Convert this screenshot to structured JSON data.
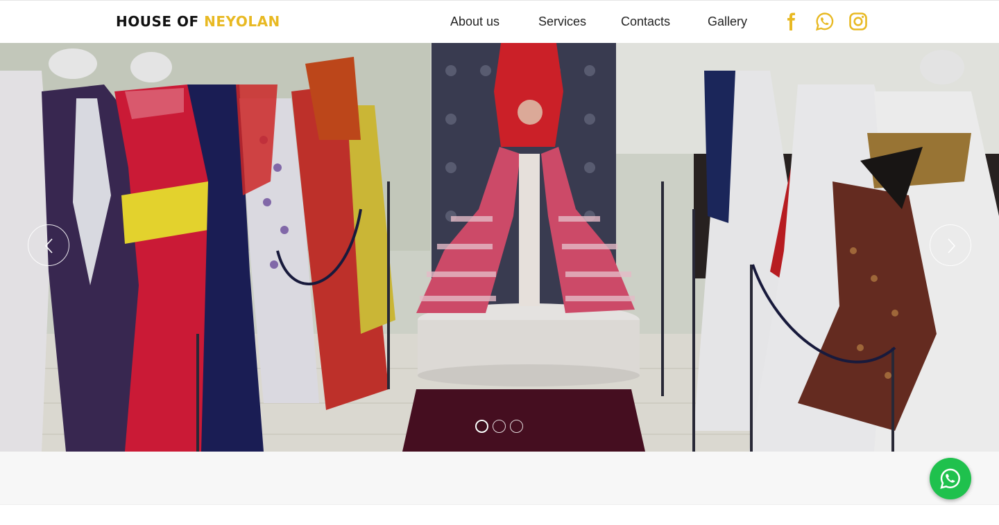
{
  "header": {
    "logo_part1": "HOUSE OF",
    "logo_part2": "NEYOLAN",
    "nav": [
      "About us",
      "Services",
      "Contacts",
      "Gallery"
    ],
    "social_icons": [
      "facebook-icon",
      "whatsapp-icon",
      "instagram-icon"
    ]
  },
  "hero": {
    "image": "dress-showroom-photo",
    "slides_total": 3,
    "active_slide": 1
  },
  "colors": {
    "accent": "#e8b923",
    "whatsapp_green": "#1fc14d"
  }
}
